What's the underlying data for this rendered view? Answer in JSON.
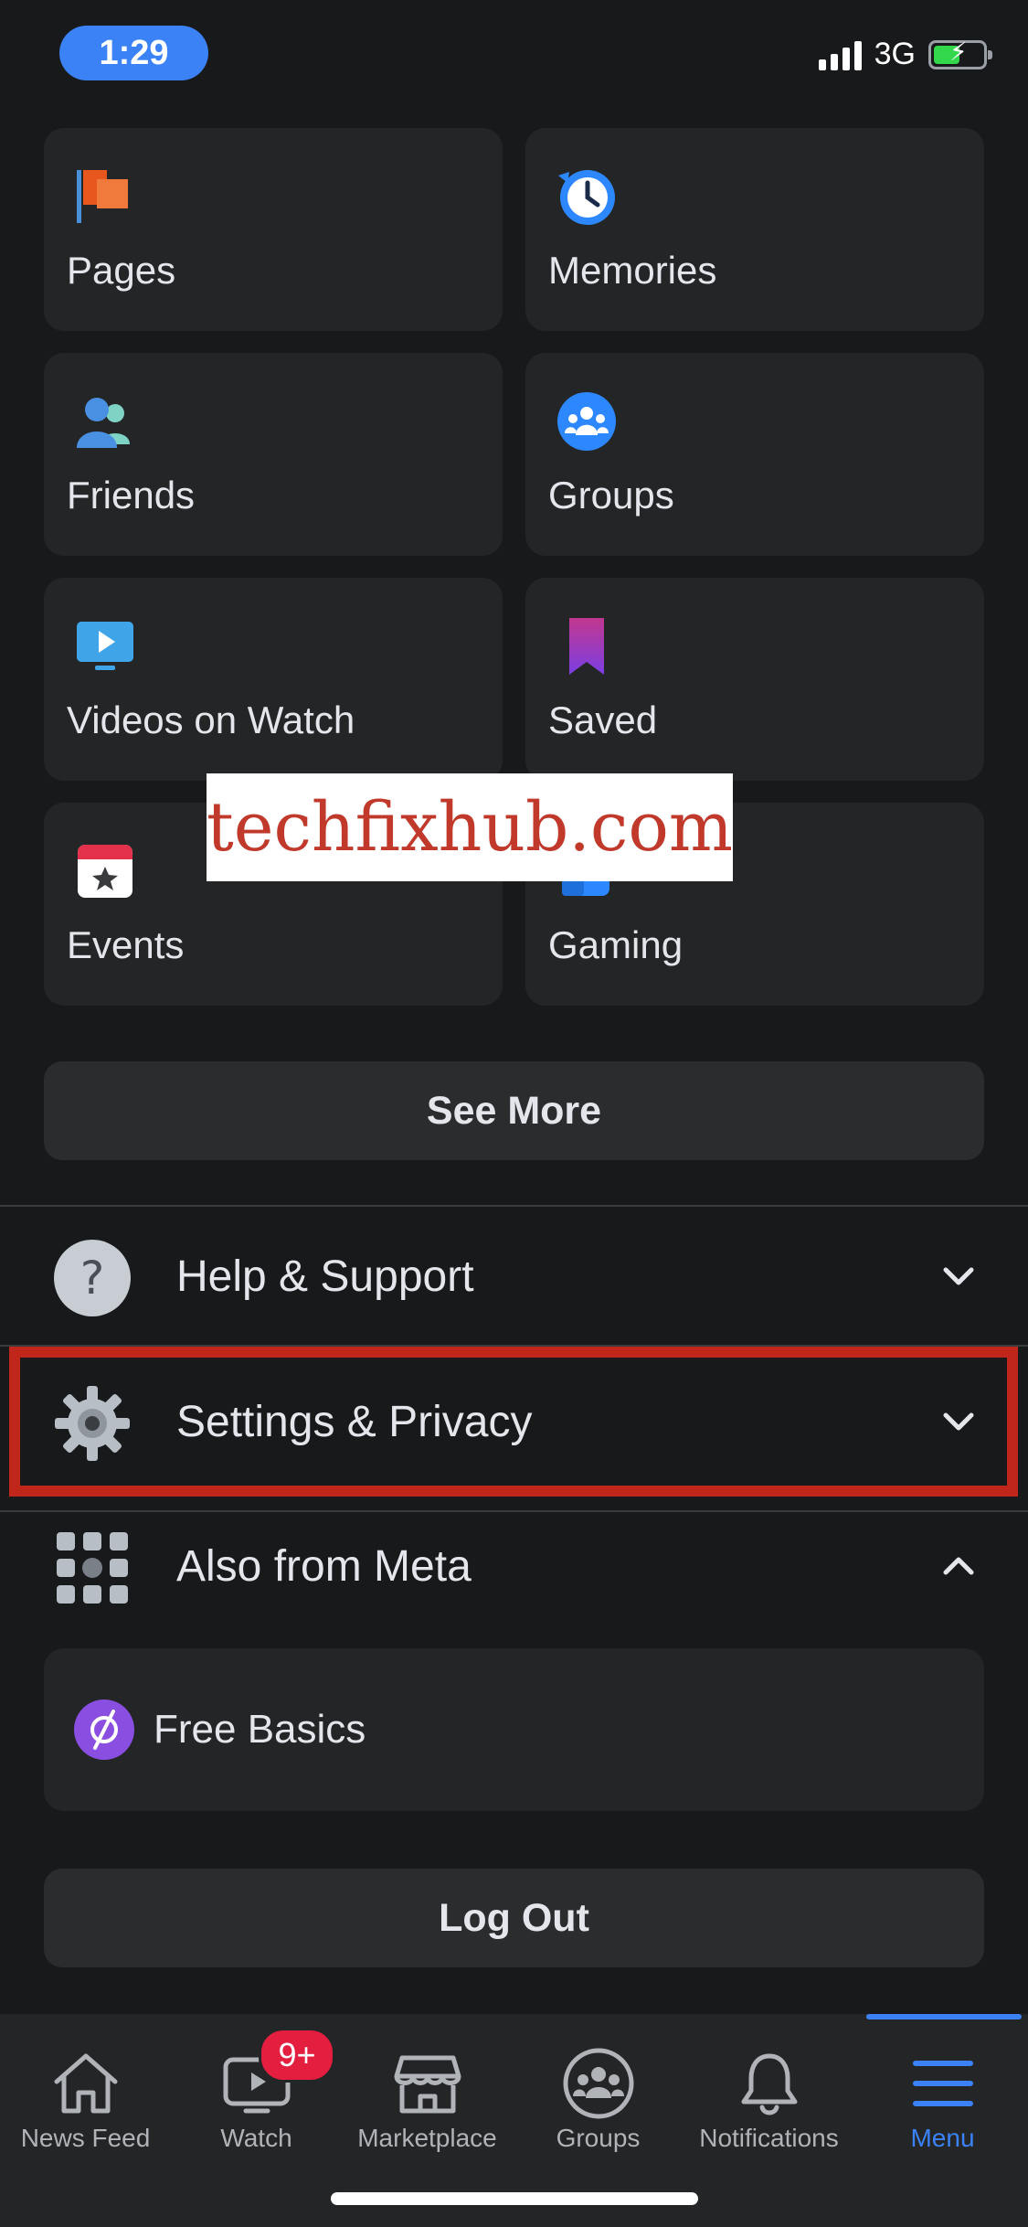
{
  "status_bar": {
    "time": "1:29",
    "network": "3G"
  },
  "shortcuts": [
    {
      "label": "Pages",
      "icon": "pages-flag-icon"
    },
    {
      "label": "Memories",
      "icon": "memories-clock-icon"
    },
    {
      "label": "Friends",
      "icon": "friends-icon"
    },
    {
      "label": "Groups",
      "icon": "groups-icon"
    },
    {
      "label": "Videos on Watch",
      "icon": "video-watch-icon"
    },
    {
      "label": "Saved",
      "icon": "saved-bookmark-icon"
    },
    {
      "label": "Events",
      "icon": "events-calendar-icon"
    },
    {
      "label": "Gaming",
      "icon": "gaming-icon"
    }
  ],
  "see_more": "See More",
  "sections": {
    "help": {
      "label": "Help & Support"
    },
    "settings": {
      "label": "Settings & Privacy"
    },
    "meta": {
      "label": "Also from Meta"
    }
  },
  "free_basics": "Free Basics",
  "log_out": "Log Out",
  "watermark": "techfixhub.com",
  "tabbar": {
    "news_feed": "News Feed",
    "watch": "Watch",
    "watch_badge": "9+",
    "marketplace": "Marketplace",
    "groups": "Groups",
    "notifications": "Notifications",
    "menu": "Menu"
  },
  "colors": {
    "accent": "#3b82f6",
    "highlight": "#c0261a",
    "badge": "#e41e3f"
  }
}
